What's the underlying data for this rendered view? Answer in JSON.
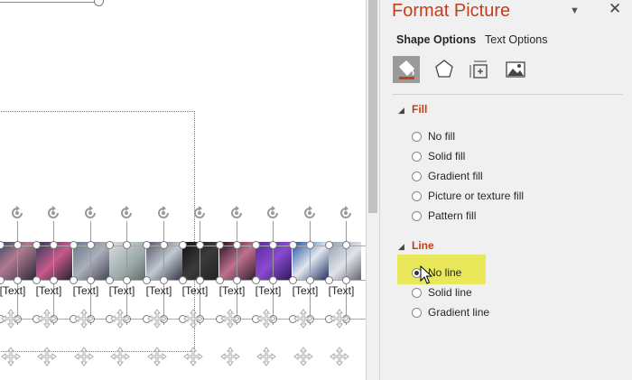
{
  "pane": {
    "title": "Format Picture",
    "tabs": {
      "shape_options": "Shape Options",
      "text_options": "Text Options"
    },
    "icons": [
      "fill-line-icon",
      "effects-icon",
      "size-properties-icon",
      "picture-icon"
    ],
    "fill": {
      "heading": "Fill",
      "options": [
        "No fill",
        "Solid fill",
        "Gradient fill",
        "Picture or texture fill",
        "Pattern fill"
      ]
    },
    "line": {
      "heading": "Line",
      "options": [
        "No line",
        "Solid line",
        "Gradient line"
      ],
      "selected": "No line"
    }
  },
  "slide": {
    "placeholder_labels": [
      "[Text]",
      "[Text]",
      "[Text]",
      "[Text]",
      "[Text]",
      "[Text]",
      "[Text]",
      "[Text]",
      "[Text]",
      "[Text]"
    ]
  },
  "colors": {
    "accent": "#c43e1c",
    "highlight": "#e8e85a"
  }
}
